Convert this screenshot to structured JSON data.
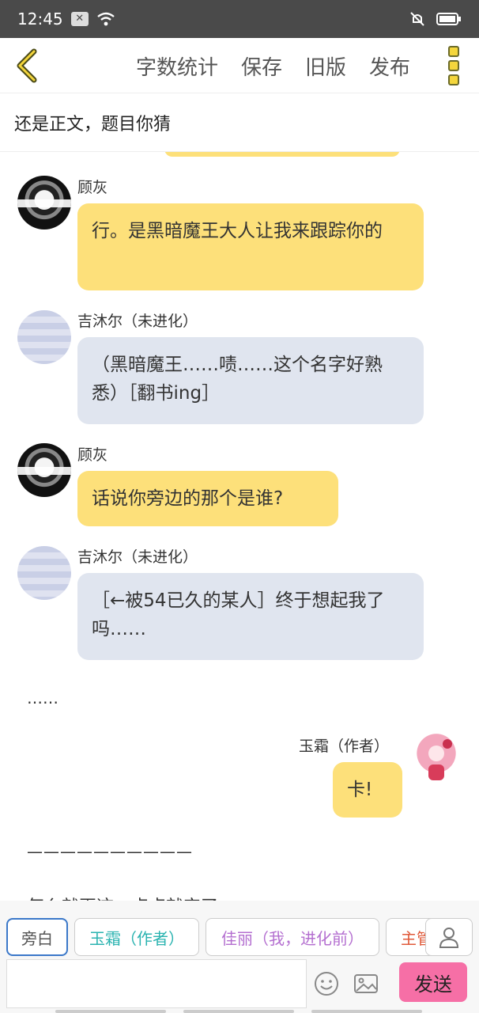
{
  "status_bar": {
    "time": "12:45"
  },
  "toolbar": {
    "actions": [
      "字数统计",
      "保存",
      "旧版",
      "发布"
    ]
  },
  "chapter_title": "还是正文，题目你猜",
  "messages": [
    {
      "sender": "顾灰",
      "text": "行。是黑暗魔王大人让我来跟踪你的"
    },
    {
      "sender": "吉沐尔（未进化）",
      "text": "（黑暗魔王……啧……这个名字好熟悉）［翻书ing］"
    },
    {
      "sender": "顾灰",
      "text": "话说你旁边的那个是谁?"
    },
    {
      "sender": "吉沐尔（未进化）",
      "text": "［←被54已久的某人］终于想起我了吗……"
    }
  ],
  "narration_1": "……",
  "author_message": {
    "sender": "玉霜（作者）",
    "text": "卡!"
  },
  "narration_2": "——————————",
  "narration_3": "怎么就再这一点点就完了",
  "roles": [
    {
      "label": "旁白",
      "color": "#555555"
    },
    {
      "label": "玉霜（作者）",
      "color": "#2ab3b0"
    },
    {
      "label": "佳丽（我，进化前）",
      "color": "#b46fd0"
    },
    {
      "label": "主管",
      "color": "#e05a3a"
    }
  ],
  "send_label": "发送",
  "colors": {
    "yellow_bubble": "#fde07a",
    "blue_bubble": "#e0e5ef",
    "send_button": "#f66fa6",
    "accent_icon": "#f4d63c"
  }
}
